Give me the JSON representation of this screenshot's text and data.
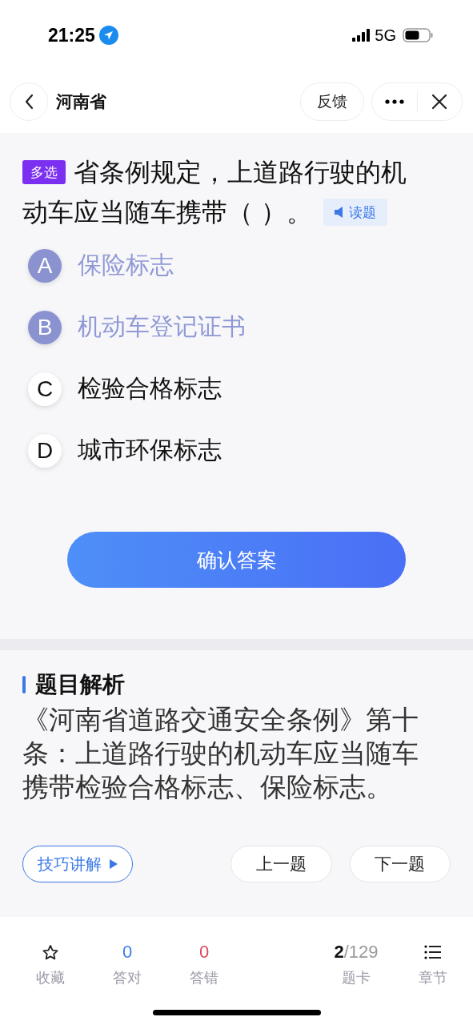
{
  "status_bar": {
    "time": "21:25",
    "network": "5G"
  },
  "nav": {
    "title": "河南省",
    "feedback_button": "反馈"
  },
  "question": {
    "type_badge": "多选",
    "text_lines": [
      "省条例规定，上道路行驶的机",
      "动车应当随车携带（ ）。"
    ],
    "read_button": "读题"
  },
  "options": [
    {
      "letter": "A",
      "text": "保险标志",
      "selected": true
    },
    {
      "letter": "B",
      "text": "机动车登记证书",
      "selected": true
    },
    {
      "letter": "C",
      "text": "检验合格标志",
      "selected": false
    },
    {
      "letter": "D",
      "text": "城市环保标志",
      "selected": false
    }
  ],
  "confirm_button": "确认答案",
  "analysis": {
    "title": "题目解析",
    "text": "《河南省道路交通安全条例》第十条：上道路行驶的机动车应当随车携带检验合格标志、保险标志。",
    "skill_button": "技巧讲解",
    "prev_button": "上一题",
    "next_button": "下一题"
  },
  "bottom_bar": [
    {
      "kind": "star",
      "label": "收藏"
    },
    {
      "kind": "count",
      "value": "0",
      "color": "#3a7ee8",
      "label": "答对"
    },
    {
      "kind": "count",
      "value": "0",
      "color": "#e0455e",
      "label": "答错"
    },
    {
      "kind": "progress",
      "current": "2",
      "total": "/129",
      "label": "题卡"
    },
    {
      "kind": "list",
      "label": "章节"
    }
  ]
}
